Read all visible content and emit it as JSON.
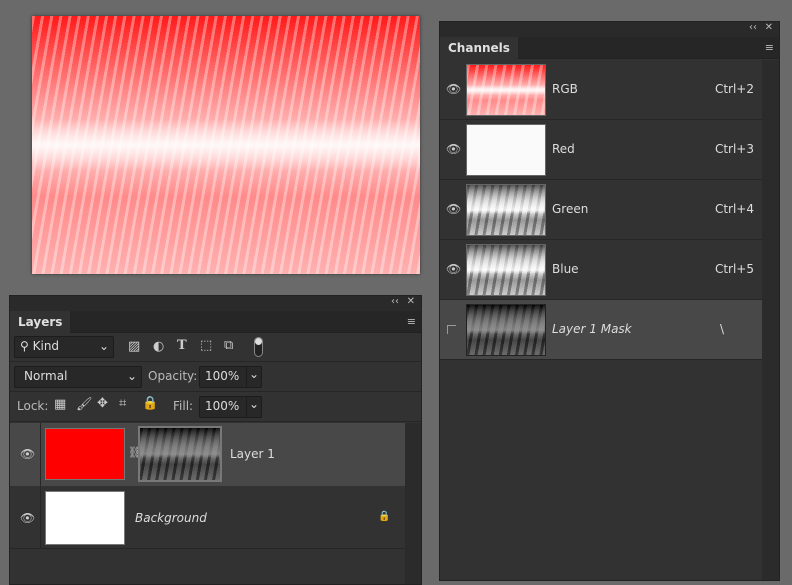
{
  "canvas": {
    "description_color": "#ff0000"
  },
  "channels": {
    "tab": "Channels",
    "collapse_icon": "‹‹",
    "close_icon": "✕",
    "menu_icon": "≡",
    "rows": [
      {
        "label": "RGB",
        "shortcut": "Ctrl+2"
      },
      {
        "label": "Red",
        "shortcut": "Ctrl+3"
      },
      {
        "label": "Green",
        "shortcut": "Ctrl+4"
      },
      {
        "label": "Blue",
        "shortcut": "Ctrl+5"
      },
      {
        "label": "Layer 1 Mask",
        "shortcut": "\\"
      }
    ]
  },
  "layers": {
    "tab": "Layers",
    "filter": "Kind",
    "blend_mode": "Normal",
    "opacity_label": "Opacity:",
    "opacity": "100%",
    "lock_label": "Lock:",
    "fill_label": "Fill:",
    "fill": "100%",
    "rows": [
      {
        "name": "Layer 1",
        "fill_color": "#ff0000"
      },
      {
        "name": "Background",
        "fill_color": "#ffffff"
      }
    ]
  }
}
